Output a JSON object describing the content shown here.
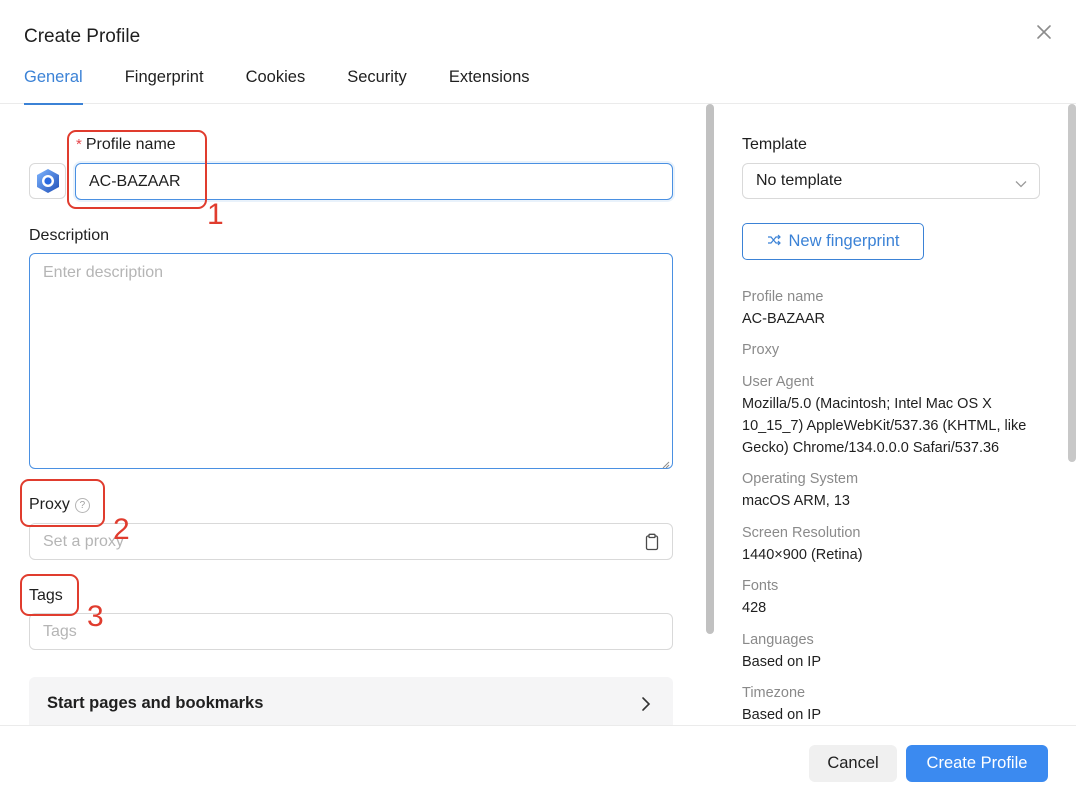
{
  "dialog": {
    "title": "Create Profile"
  },
  "tabs": [
    {
      "label": "General",
      "active": true
    },
    {
      "label": "Fingerprint",
      "active": false
    },
    {
      "label": "Cookies",
      "active": false
    },
    {
      "label": "Security",
      "active": false
    },
    {
      "label": "Extensions",
      "active": false
    }
  ],
  "form": {
    "required_mark": "*",
    "profile_name_label": "Profile name",
    "profile_name_value": "AC-BAZAAR",
    "description_label": "Description",
    "description_placeholder": "Enter description",
    "proxy_label": "Proxy",
    "proxy_help": "?",
    "proxy_placeholder": "Set a proxy",
    "tags_label": "Tags",
    "tags_placeholder": "Tags",
    "start_pages_label": "Start pages and bookmarks"
  },
  "annotations": [
    "1",
    "2",
    "3"
  ],
  "sidebar": {
    "template_label": "Template",
    "template_value": "No template",
    "new_fingerprint_label": "New fingerprint",
    "info": [
      {
        "key": "Profile name",
        "value": "AC-BAZAAR"
      },
      {
        "key": "Proxy",
        "value": ""
      },
      {
        "key": "User Agent",
        "value": "Mozilla/5.0 (Macintosh; Intel Mac OS X 10_15_7) AppleWebKit/537.36 (KHTML, like Gecko) Chrome/134.0.0.0 Safari/537.36"
      },
      {
        "key": "Operating System",
        "value": "macOS ARM, 13"
      },
      {
        "key": "Screen Resolution",
        "value": "1440×900 (Retina)"
      },
      {
        "key": "Fonts",
        "value": "428"
      },
      {
        "key": "Languages",
        "value": "Based on IP"
      },
      {
        "key": "Timezone",
        "value": "Based on IP"
      }
    ]
  },
  "footer": {
    "cancel_label": "Cancel",
    "create_label": "Create Profile"
  },
  "colors": {
    "accent": "#3b82d6",
    "primary_button": "#3b8af0",
    "annotation": "#e03c2e"
  },
  "icons": [
    "close-icon",
    "profile-avatar-icon",
    "help-icon",
    "clipboard-icon",
    "chevron-down-icon",
    "shuffle-icon",
    "chevron-right-icon"
  ]
}
